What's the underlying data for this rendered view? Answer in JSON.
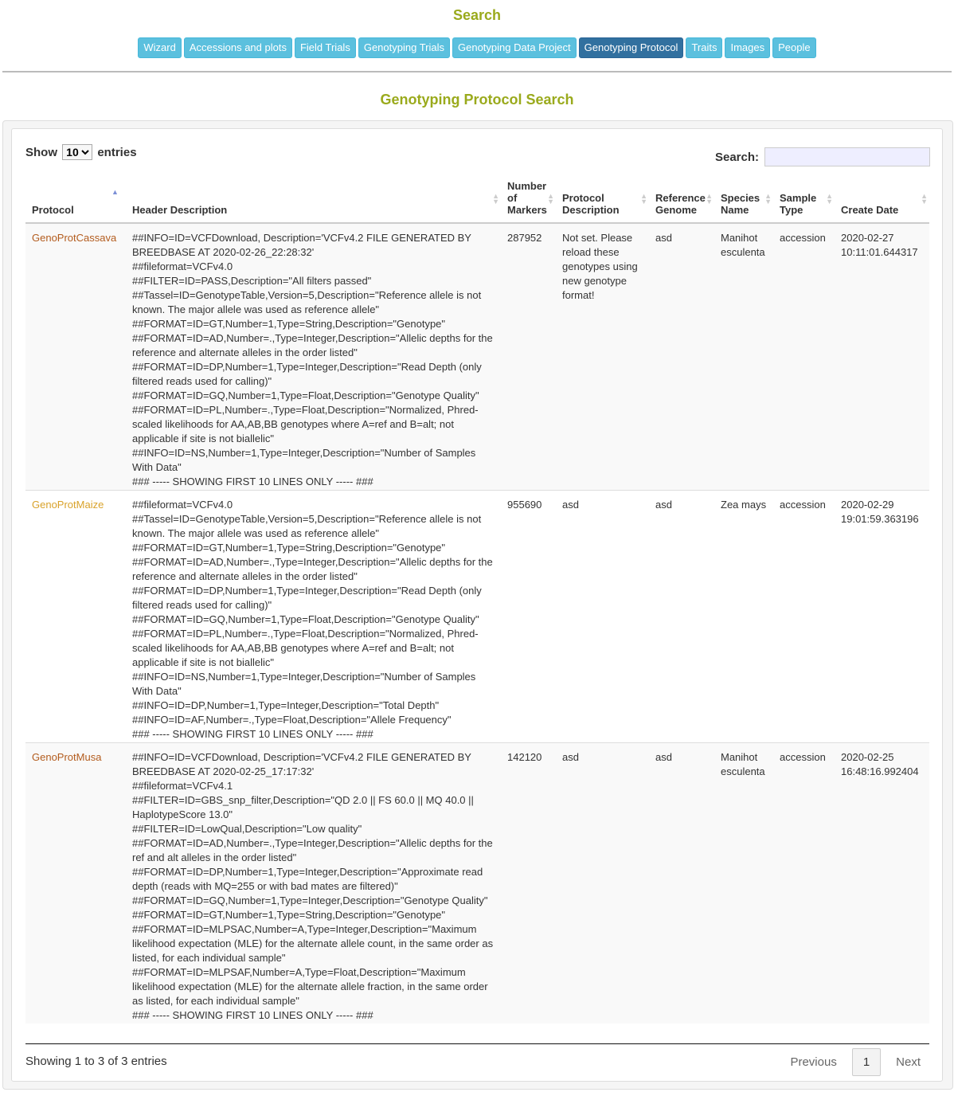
{
  "page_title": "Search",
  "nav": [
    {
      "label": "Wizard",
      "active": false
    },
    {
      "label": "Accessions and plots",
      "active": false
    },
    {
      "label": "Field Trials",
      "active": false
    },
    {
      "label": "Genotyping Trials",
      "active": false
    },
    {
      "label": "Genotyping Data Project",
      "active": false
    },
    {
      "label": "Genotyping Protocol",
      "active": true
    },
    {
      "label": "Traits",
      "active": false
    },
    {
      "label": "Images",
      "active": false
    },
    {
      "label": "People",
      "active": false
    }
  ],
  "section_title": "Genotyping Protocol Search",
  "length": {
    "show": "Show",
    "value": "10",
    "entries": "entries"
  },
  "filter": {
    "label": "Search:",
    "value": ""
  },
  "columns": [
    "Protocol",
    "Header Description",
    "Number of Markers",
    "Protocol Description",
    "Reference Genome",
    "Species Name",
    "Sample Type",
    "Create Date"
  ],
  "rows": [
    {
      "protocol": "GenoProtCassava",
      "header_lines": [
        "##INFO=ID=VCFDownload, Description='VCFv4.2 FILE GENERATED BY BREEDBASE AT 2020-02-26_22:28:32'",
        "##fileformat=VCFv4.0",
        "##FILTER=ID=PASS,Description=\"All filters passed\"",
        "##Tassel=ID=GenotypeTable,Version=5,Description=\"Reference allele is not known. The major allele was used as reference allele\"",
        "##FORMAT=ID=GT,Number=1,Type=String,Description=\"Genotype\"",
        "##FORMAT=ID=AD,Number=.,Type=Integer,Description=\"Allelic depths for the reference and alternate alleles in the order listed\"",
        "##FORMAT=ID=DP,Number=1,Type=Integer,Description=\"Read Depth (only filtered reads used for calling)\"",
        "##FORMAT=ID=GQ,Number=1,Type=Float,Description=\"Genotype Quality\"",
        "##FORMAT=ID=PL,Number=.,Type=Float,Description=\"Normalized, Phred-scaled likelihoods for AA,AB,BB genotypes where A=ref and B=alt; not applicable if site is not biallelic\"",
        "##INFO=ID=NS,Number=1,Type=Integer,Description=\"Number of Samples With Data\"",
        "### ----- SHOWING FIRST 10 LINES ONLY ----- ###"
      ],
      "markers": "287952",
      "description": "Not set. Please reload these genotypes using new genotype format!",
      "reference": "asd",
      "species": "Manihot esculenta",
      "sample_type": "accession",
      "create_date": "2020-02-27 10:11:01.644317"
    },
    {
      "protocol": "GenoProtMaize",
      "header_lines": [
        "##fileformat=VCFv4.0",
        "##Tassel=ID=GenotypeTable,Version=5,Description=\"Reference allele is not known. The major allele was used as reference allele\"",
        "##FORMAT=ID=GT,Number=1,Type=String,Description=\"Genotype\"",
        "##FORMAT=ID=AD,Number=.,Type=Integer,Description=\"Allelic depths for the reference and alternate alleles in the order listed\"",
        "##FORMAT=ID=DP,Number=1,Type=Integer,Description=\"Read Depth (only filtered reads used for calling)\"",
        "##FORMAT=ID=GQ,Number=1,Type=Float,Description=\"Genotype Quality\"",
        "##FORMAT=ID=PL,Number=.,Type=Float,Description=\"Normalized, Phred-scaled likelihoods for AA,AB,BB genotypes where A=ref and B=alt; not applicable if site is not biallelic\"",
        "##INFO=ID=NS,Number=1,Type=Integer,Description=\"Number of Samples With Data\"",
        "##INFO=ID=DP,Number=1,Type=Integer,Description=\"Total Depth\"",
        "##INFO=ID=AF,Number=.,Type=Float,Description=\"Allele Frequency\"",
        "### ----- SHOWING FIRST 10 LINES ONLY ----- ###"
      ],
      "markers": "955690",
      "description": "asd",
      "reference": "asd",
      "species": "Zea mays",
      "sample_type": "accession",
      "create_date": "2020-02-29 19:01:59.363196"
    },
    {
      "protocol": "GenoProtMusa",
      "header_lines": [
        "##INFO=ID=VCFDownload, Description='VCFv4.2 FILE GENERATED BY BREEDBASE AT 2020-02-25_17:17:32'",
        "##fileformat=VCFv4.1",
        "##FILTER=ID=GBS_snp_filter,Description=\"QD 2.0 || FS 60.0 || MQ 40.0 || HaplotypeScore 13.0\"",
        "##FILTER=ID=LowQual,Description=\"Low quality\"",
        "##FORMAT=ID=AD,Number=.,Type=Integer,Description=\"Allelic depths for the ref and alt alleles in the order listed\"",
        "##FORMAT=ID=DP,Number=1,Type=Integer,Description=\"Approximate read depth (reads with MQ=255 or with bad mates are filtered)\"",
        "##FORMAT=ID=GQ,Number=1,Type=Integer,Description=\"Genotype Quality\"",
        "##FORMAT=ID=GT,Number=1,Type=String,Description=\"Genotype\"",
        "##FORMAT=ID=MLPSAC,Number=A,Type=Integer,Description=\"Maximum likelihood expectation (MLE) for the alternate allele count, in the same order as listed, for each individual sample\"",
        "##FORMAT=ID=MLPSAF,Number=A,Type=Float,Description=\"Maximum likelihood expectation (MLE) for the alternate allele fraction, in the same order as listed, for each individual sample\"",
        "### ----- SHOWING FIRST 10 LINES ONLY ----- ###"
      ],
      "markers": "142120",
      "description": "asd",
      "reference": "asd",
      "species": "Manihot esculenta",
      "sample_type": "accession",
      "create_date": "2020-02-25 16:48:16.992404"
    }
  ],
  "info": "Showing 1 to 3 of 3 entries",
  "paging": {
    "previous": "Previous",
    "current": "1",
    "next": "Next"
  }
}
